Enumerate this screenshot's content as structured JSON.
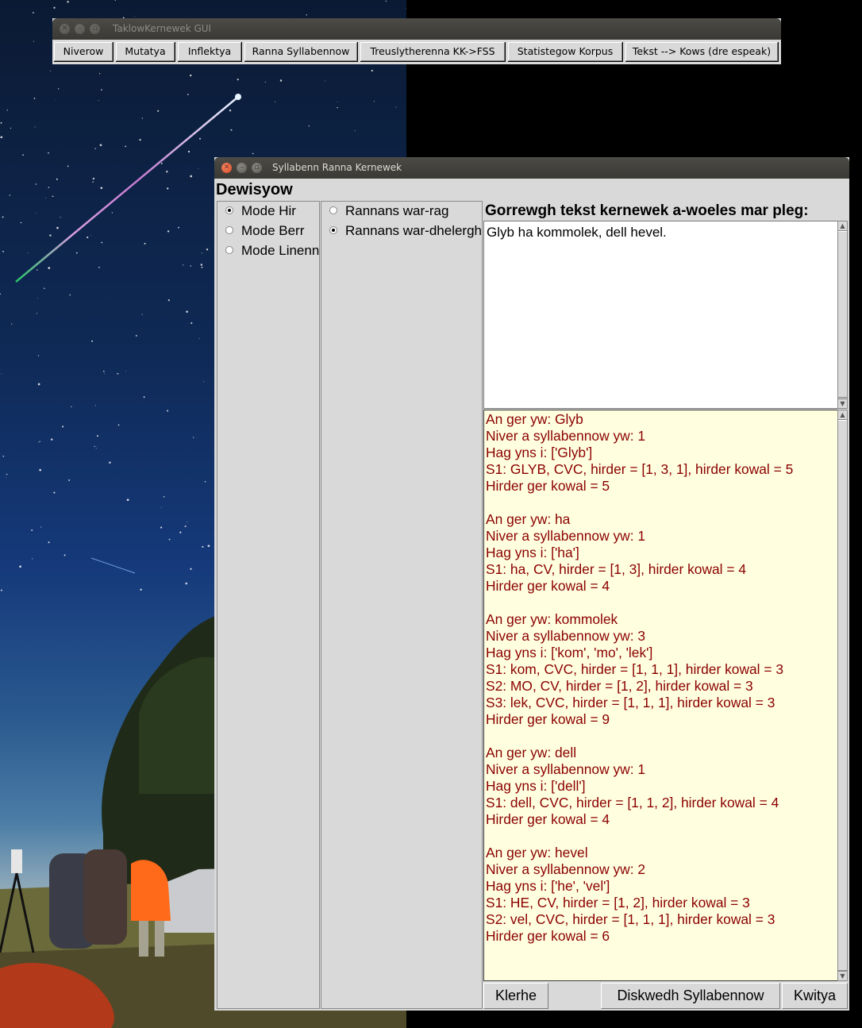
{
  "main_window": {
    "title": "TaklowKernewek GUI",
    "buttons": [
      {
        "label": "Niverow"
      },
      {
        "label": "Mutatya"
      },
      {
        "label": "Inflektya"
      },
      {
        "label": "Ranna Syllabennow"
      },
      {
        "label": "Treuslytherenna KK->FSS"
      },
      {
        "label": "Statistegow Korpus"
      },
      {
        "label": "Tekst --> Kows (dre espeak)"
      }
    ]
  },
  "syllable_window": {
    "title": "Syllabenn Ranna Kernewek",
    "options_label": "Dewisyow",
    "mode_options": [
      {
        "label": "Mode Hir",
        "selected": true
      },
      {
        "label": "Mode Berr",
        "selected": false
      },
      {
        "label": "Mode Linenn",
        "selected": false
      }
    ],
    "split_options": [
      {
        "label": "Rannans war-rag",
        "selected": false
      },
      {
        "label": "Rannans war-dhelergh",
        "selected": true
      }
    ],
    "input_label": "Gorrewgh tekst kernewek a-woeles mar pleg:",
    "input_text": "Glyb ha kommolek, dell hevel.",
    "output_lines": [
      "An ger yw: Glyb",
      "Niver a syllabennow yw: 1",
      "Hag yns i: ['Glyb']",
      "S1: GLYB, CVC, hirder = [1, 3, 1], hirder kowal = 5",
      "Hirder ger kowal = 5",
      "",
      "An ger yw: ha",
      "Niver a syllabennow yw: 1",
      "Hag yns i: ['ha']",
      "S1: ha, CV, hirder = [1, 3], hirder kowal = 4",
      "Hirder ger kowal = 4",
      "",
      "An ger yw: kommolek",
      "Niver a syllabennow yw: 3",
      "Hag yns i: ['kom', 'mo', 'lek']",
      "S1: kom, CVC, hirder = [1, 1, 1], hirder kowal = 3",
      "S2: MO, CV, hirder = [1, 2], hirder kowal = 3",
      "S3: lek, CVC, hirder = [1, 1, 1], hirder kowal = 3",
      "Hirder ger kowal = 9",
      "",
      "An ger yw: dell",
      "Niver a syllabennow yw: 1",
      "Hag yns i: ['dell']",
      "S1: dell, CVC, hirder = [1, 1, 2], hirder kowal = 4",
      "Hirder ger kowal = 4",
      "",
      "An ger yw: hevel",
      "Niver a syllabennow yw: 2",
      "Hag yns i: ['he', 'vel']",
      "S1: HE, CV, hirder = [1, 2], hirder kowal = 3",
      "S2: vel, CVC, hirder = [1, 1, 1], hirder kowal = 3",
      "Hirder ger kowal = 6"
    ],
    "buttons": {
      "clear": "Klerhe",
      "show": "Diskwedh Syllabennow",
      "quit": "Kwitya"
    }
  },
  "icons": {
    "close": "close-icon",
    "minimize": "minimize-icon",
    "maximize": "maximize-icon"
  },
  "colors": {
    "output_text": "#8b0000",
    "output_background": "#ffffe0",
    "window_background": "#d9d9d9",
    "titlebar": "#3c3b37"
  }
}
